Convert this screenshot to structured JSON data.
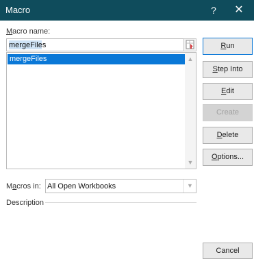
{
  "window": {
    "title": "Macro",
    "help_label": "?",
    "close_label": "✕"
  },
  "macro_name": {
    "label_underlined": "M",
    "label_rest": "acro name:",
    "value": "mergeFiles"
  },
  "macro_list": {
    "items": [
      "mergeFiles"
    ],
    "selected_index": 0
  },
  "buttons": {
    "run": {
      "u": "R",
      "rest": "un"
    },
    "step_into": {
      "u": "S",
      "rest": "tep Into"
    },
    "edit": {
      "u": "E",
      "rest": "dit"
    },
    "create": {
      "label": "Create"
    },
    "delete": {
      "u": "D",
      "rest": "elete"
    },
    "options": {
      "u": "O",
      "rest": "ptions..."
    },
    "cancel": {
      "label": "Cancel"
    }
  },
  "macros_in": {
    "label_pre": "M",
    "label_underlined": "a",
    "label_rest": "cros in:",
    "value": "All Open Workbooks"
  },
  "description": {
    "label": "Description"
  },
  "colors": {
    "titlebar": "#0f4c5c",
    "selection": "#0a78d7"
  }
}
